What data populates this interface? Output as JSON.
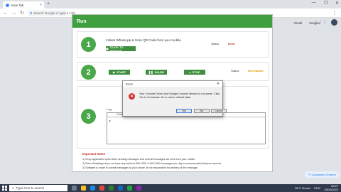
{
  "browser": {
    "tab_title": "New Tab",
    "tab_close": "×",
    "new_tab": "+",
    "window_controls": [
      "—",
      "❐",
      "✕"
    ],
    "nav": {
      "back": "←",
      "forward": "→",
      "reload": "↻"
    },
    "omnibox_placeholder": "Search Google or type a URL",
    "menu": "⋮",
    "google_links": [
      "Gmail",
      "Images"
    ],
    "apps_icon": "⋮⋮⋮"
  },
  "app": {
    "title": "Run",
    "step1": {
      "number": "1",
      "description": "Initiate WhatsApp & Scan QR Code from your mobile",
      "button": "CLICK TO INITIATE",
      "status_label": "Status",
      "status_value": "Error"
    },
    "step2": {
      "number": "2",
      "start": "START",
      "pause": "PAUSE",
      "stop": "STOP",
      "status_label": "Status",
      "status_value": "Not Started"
    },
    "step3": {
      "number": "3",
      "log_label": "Log",
      "log_header": "Chrome",
      "log_row": "▸"
    },
    "notes": {
      "title": "Important Notes",
      "lines": [
        "1) Keep application open while sending messages and until all messages are sent from your mobile",
        "2) Even WhatsApp does not have any limit but 500-1000 / 1000-2000 messages per day is recommended limit per account",
        "3) Software is made to submit messages to your phone, is not responsible for delivery of the message"
      ]
    }
  },
  "dialog": {
    "title": "Error",
    "close": "✕",
    "icon": "✕",
    "message": "Your Chrome Driver and Google Chrome Version is not same. Click Yes to Download. No to return default state.",
    "yes": "Yes",
    "no": "No",
    "cancel": "Cancel"
  },
  "customize": "✎ Customize Chrome",
  "taskbar": {
    "search_placeholder": "Type here to search",
    "weather": "28°C Smoke",
    "lang": "ENG",
    "time": "09:27",
    "date": "13/04/2022"
  },
  "colors": {
    "accent_green": "#3ea03e",
    "status_error": "#c0392b",
    "status_not_started": "#e0a000"
  }
}
